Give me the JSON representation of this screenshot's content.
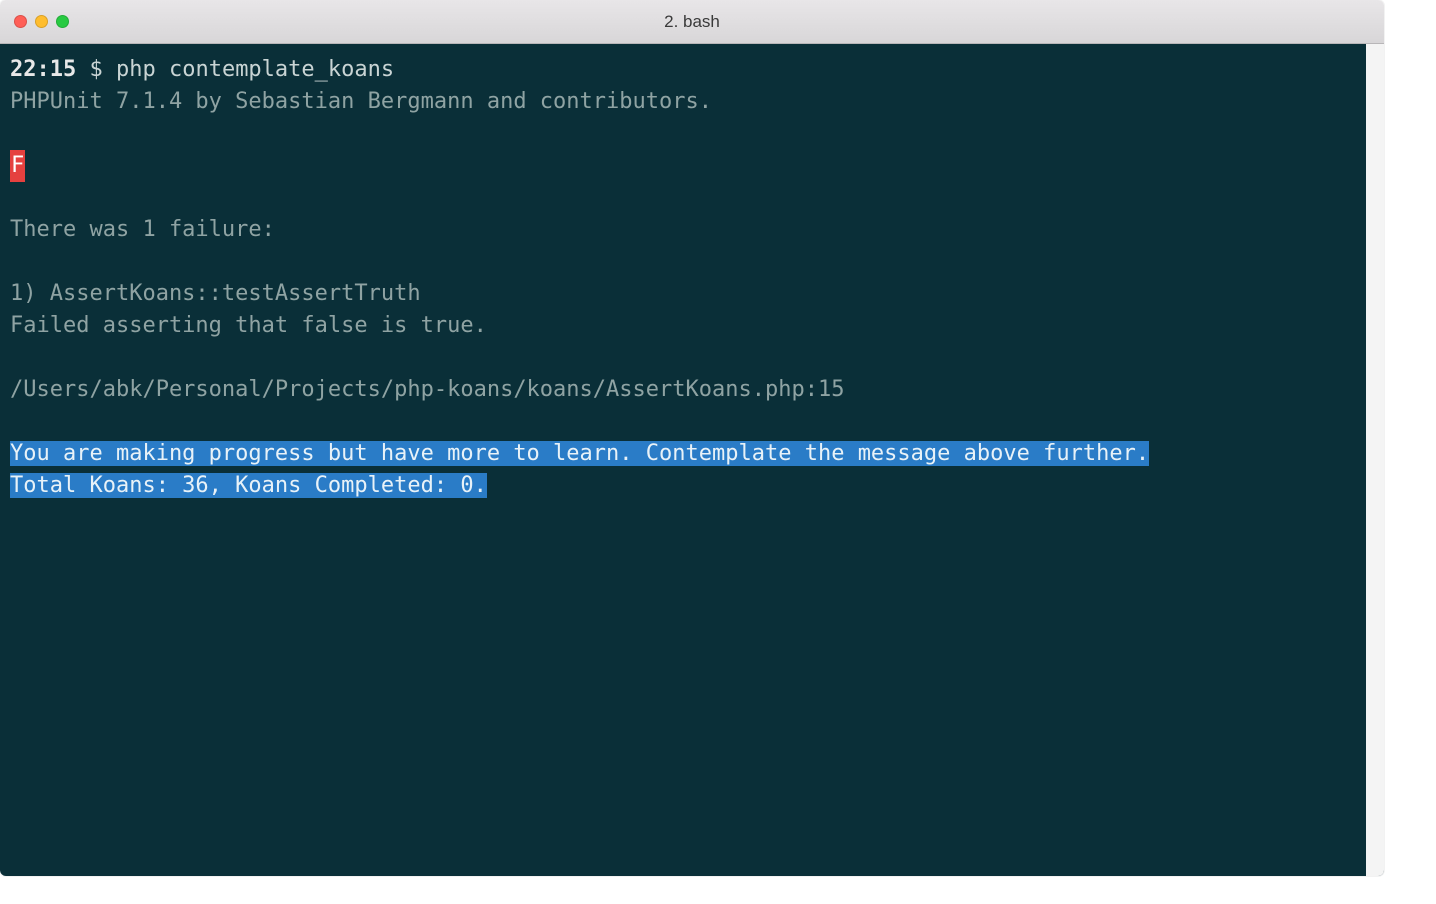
{
  "window": {
    "title": "2. bash"
  },
  "terminal": {
    "prompt_time": "22:15",
    "prompt_symbol": "$",
    "command": "php contemplate_koans",
    "phpunit_line": "PHPUnit 7.1.4 by Sebastian Bergmann and contributors.",
    "failure_marker": "F",
    "failure_header": "There was 1 failure:",
    "failure_test": "1) AssertKoans::testAssertTruth",
    "failure_message": "Failed asserting that false is true.",
    "failure_path": "/Users/abk/Personal/Projects/php-koans/koans/AssertKoans.php:15",
    "progress_line1": "You are making progress but have more to learn. Contemplate the message above further.",
    "progress_line2": "Total Koans: 36, Koans Completed: 0."
  },
  "colors": {
    "terminal_bg": "#0a2f38",
    "text_primary": "#c9d4d4",
    "text_dim": "#8fa3a3",
    "failure_bg": "#e5413f",
    "highlight_bg": "#2a7cc7"
  }
}
